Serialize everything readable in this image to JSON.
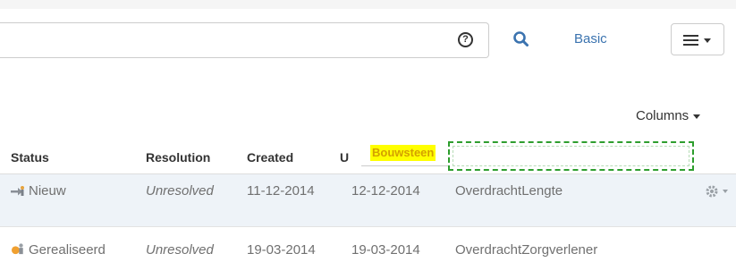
{
  "toolbar": {
    "help_icon": "question-circle-icon",
    "help_glyph": "?",
    "search_icon": "search-icon",
    "basic_label": "Basic",
    "menu_icon": "hamburger-menu-icon"
  },
  "columns_button": {
    "label": "Columns"
  },
  "table": {
    "headers": {
      "status": "Status",
      "resolution": "Resolution",
      "created": "Created",
      "updated_partial": "U"
    },
    "drag_label": "Bouwsteen",
    "rows": [
      {
        "status": "Nieuw",
        "status_icon": "new-status-arrow-icon",
        "resolution": "Unresolved",
        "created": "11-12-2014",
        "updated": "12-12-2014",
        "bouwsteen": "OverdrachtLengte"
      },
      {
        "status": "Gerealiseerd",
        "status_icon": "realized-status-icon",
        "resolution": "Unresolved",
        "created": "19-03-2014",
        "updated": "19-03-2014",
        "bouwsteen": "OverdrachtZorgverlener"
      }
    ]
  },
  "colors": {
    "link": "#3b73af",
    "highlight": "#ffff00",
    "drop_border": "#2e9e2e",
    "row_selected": "#eef3f8"
  }
}
